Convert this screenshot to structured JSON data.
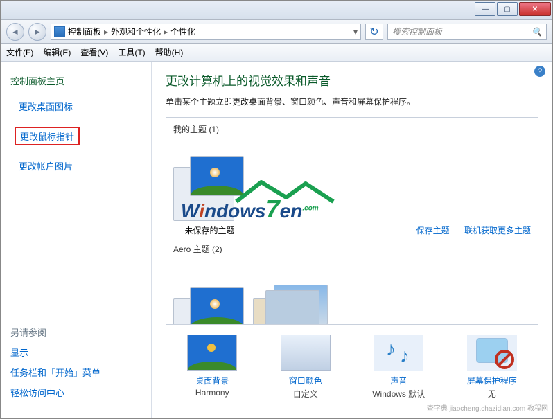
{
  "titlebar": {
    "min": "—",
    "max": "▢",
    "close": "✕"
  },
  "navbar": {
    "back": "◄",
    "fwd": "►",
    "path": [
      "控制面板",
      "外观和个性化",
      "个性化"
    ],
    "sep": "▸",
    "dropdown": "▾",
    "refresh": "↻",
    "search_placeholder": "搜索控制面板",
    "search_icon": "🔍"
  },
  "menu": {
    "file": "文件(F)",
    "edit": "编辑(E)",
    "view": "查看(V)",
    "tools": "工具(T)",
    "help": "帮助(H)"
  },
  "sidebar": {
    "home": "控制面板主页",
    "links": [
      "更改桌面图标",
      "更改鼠标指针",
      "更改帐户图片"
    ],
    "seealso": {
      "hdr": "另请参阅",
      "items": [
        "显示",
        "任务栏和「开始」菜单",
        "轻松访问中心"
      ]
    }
  },
  "main": {
    "help": "?",
    "title": "更改计算机上的视觉效果和声音",
    "desc": "单击某个主题立即更改桌面背景、窗口颜色、声音和屏幕保护程序。",
    "my_themes": "我的主题 (1)",
    "unsaved": "未保存的主题",
    "save": "保存主题",
    "online": "联机获取更多主题",
    "aero": "Aero 主题 (2)",
    "opts": {
      "bg": {
        "t": "桌面背景",
        "s": "Harmony"
      },
      "win": {
        "t": "窗口颜色",
        "s": "自定义"
      },
      "snd": {
        "t": "声音",
        "s": "Windows 默认"
      },
      "scr": {
        "t": "屏幕保护程序",
        "s": "无"
      }
    }
  },
  "watermark": {
    "text_prefix": "W",
    "text_i": "i",
    "text_ndows": "ndows",
    "seven": "7",
    "dotcom": ".com",
    "en": "en"
  },
  "footer": "查字典 jiaocheng.chazidian.com 教程网"
}
